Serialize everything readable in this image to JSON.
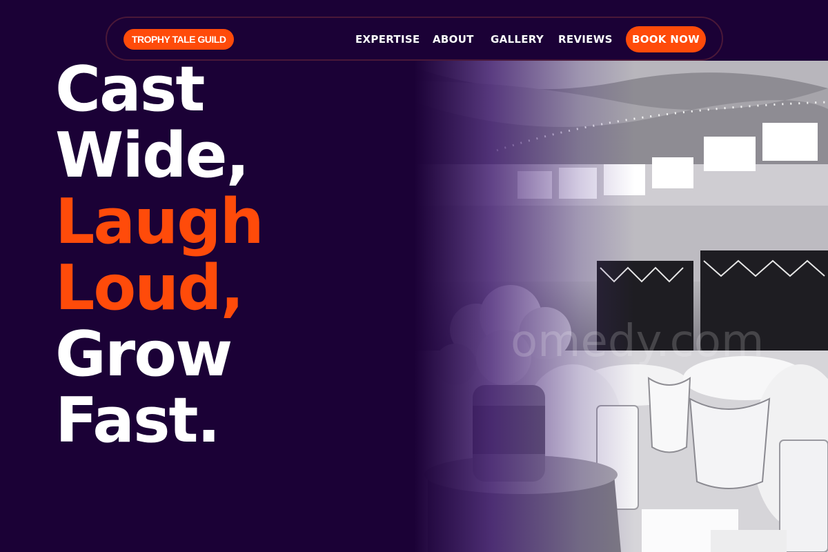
{
  "nav": {
    "brand": "TROPHY TALE GUILD",
    "links": [
      "EXPERTISE",
      "ABOUT",
      "GALLERY",
      "REVIEWS"
    ],
    "cta": "BOOK NOW"
  },
  "hero": {
    "lines": [
      "Cast",
      "Wide,",
      "Laugh",
      "Loud,",
      "Grow",
      "Fast."
    ],
    "highlight_lines": [
      2,
      3
    ],
    "watermark": "omedy.com"
  },
  "colors": {
    "background": "#1b0136",
    "accent": "#ff4b0a",
    "text": "#ffffff"
  }
}
